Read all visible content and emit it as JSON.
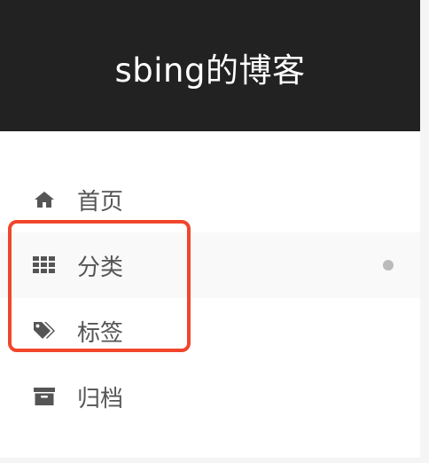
{
  "site": {
    "title": "sbing的博客"
  },
  "menu": {
    "items": [
      {
        "label": "首页",
        "icon": "home-icon",
        "active": false
      },
      {
        "label": "分类",
        "icon": "th-grid-icon",
        "active": true
      },
      {
        "label": "标签",
        "icon": "tags-icon",
        "active": false
      },
      {
        "label": "归档",
        "icon": "archive-icon",
        "active": false
      }
    ]
  },
  "colors": {
    "header_bg": "#222222",
    "header_text": "#ffffff",
    "menu_text": "#555555",
    "icon": "#555555",
    "active_bg": "#f9f9f9",
    "active_dot": "#bbbbbb",
    "annotation_border": "#f0462c"
  }
}
